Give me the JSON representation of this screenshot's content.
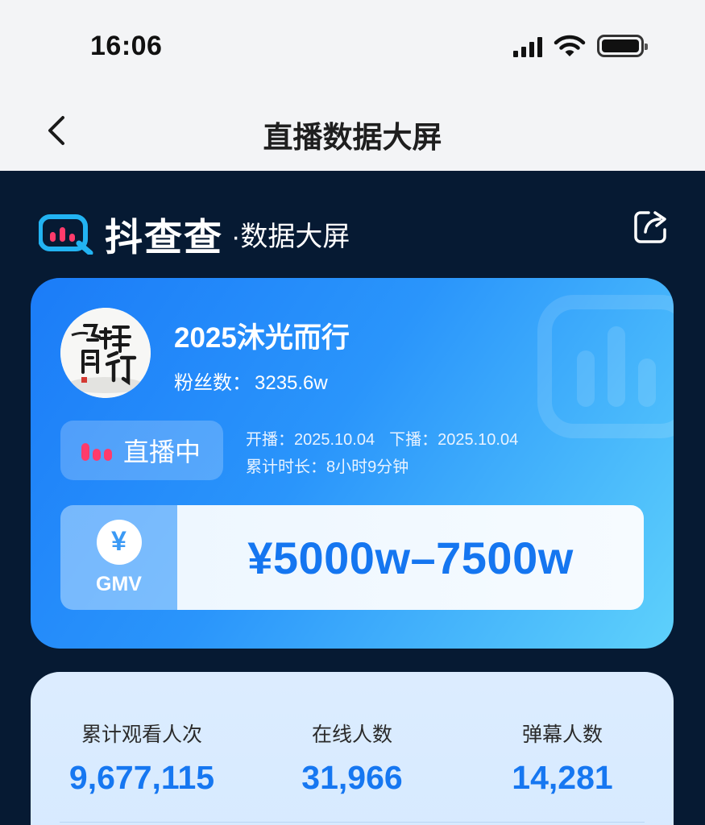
{
  "status_bar": {
    "time": "16:06",
    "signal": "signal-icon",
    "wifi": "wifi-icon",
    "battery": "battery-icon"
  },
  "nav": {
    "title": "直播数据大屏",
    "back_icon": "chevron-left-icon"
  },
  "brand": {
    "name": "抖查查",
    "subtitle": "·数据大屏",
    "share_icon": "share-icon",
    "accent": "#1fa8f4"
  },
  "live": {
    "anchor_name": "2025沐光而行",
    "fans_label": "粉丝数：",
    "fans_value": "3235.6w",
    "status_label": "直播中",
    "start_label": "开播：",
    "start_date": "2025.10.04",
    "end_label": "下播：",
    "end_date": "2025.10.04",
    "duration_label": "累计时长：",
    "duration_value": "8小时9分钟",
    "gmv_symbol": "¥",
    "gmv_label": "GMV",
    "gmv_value": "¥5000w–7500w"
  },
  "stats": [
    {
      "label": "累计观看人次",
      "value": "9,677,115"
    },
    {
      "label": "在线人数",
      "value": "31,966"
    },
    {
      "label": "弹幕人数",
      "value": "14,281"
    }
  ],
  "colors": {
    "dark_bg": "#061a33",
    "card_blue": "#1b7cf8",
    "value_blue": "#1677f1",
    "live_red": "#ff3b6b"
  }
}
